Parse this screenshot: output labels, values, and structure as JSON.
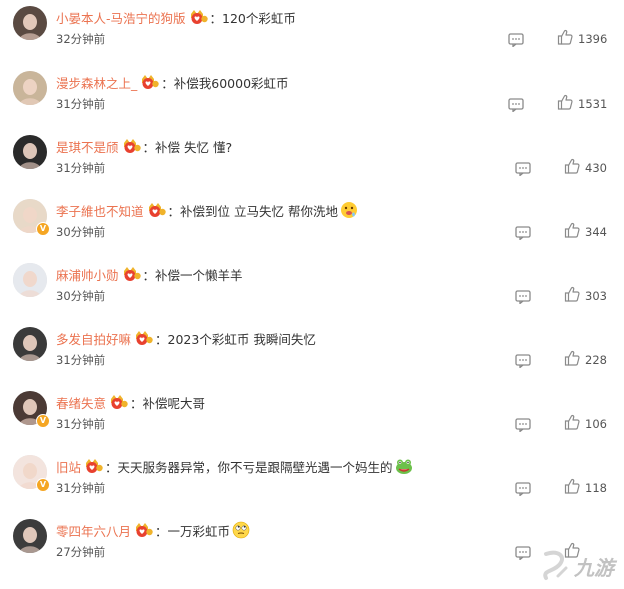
{
  "comments": [
    {
      "username": "小晏本人-马浩宁的狗版",
      "text": "120个彩虹币",
      "time": "32分钟前",
      "likes": "1396",
      "verified": false,
      "emoji": "",
      "avatar_color": "#5a4a42"
    },
    {
      "username": "漫步森林之上_",
      "text": "补偿我60000彩虹币",
      "time": "31分钟前",
      "likes": "1531",
      "verified": false,
      "emoji": "",
      "avatar_color": "#c9b59a"
    },
    {
      "username": "是琪不是颀",
      "text": "补偿 失忆 懂?",
      "time": "31分钟前",
      "likes": "430",
      "verified": false,
      "emoji": "",
      "avatar_color": "#2a2a2a"
    },
    {
      "username": "李子維也不知道",
      "text": "补偿到位 立马失忆 帮你洗地",
      "time": "30分钟前",
      "likes": "344",
      "verified": true,
      "emoji": "drool-face-emoji",
      "avatar_color": "#e8d9c8"
    },
    {
      "username": "麻浦帅小勋",
      "text": "补偿一个懒羊羊",
      "time": "30分钟前",
      "likes": "303",
      "verified": false,
      "emoji": "",
      "avatar_color": "#e6e9ee"
    },
    {
      "username": "多发自拍好嘛",
      "text": "2023个彩虹币 我瞬间失忆",
      "time": "31分钟前",
      "likes": "228",
      "verified": false,
      "emoji": "",
      "avatar_color": "#3a3a3a"
    },
    {
      "username": "春绪失意",
      "text": "补偿呢大哥",
      "time": "31分钟前",
      "likes": "106",
      "verified": true,
      "emoji": "",
      "avatar_color": "#4b3a35"
    },
    {
      "username": "旧站",
      "text": "天天服务器异常，你不亏是跟隔壁光遇一个妈生的",
      "time": "31分钟前",
      "likes": "118",
      "verified": true,
      "emoji": "frog-emoji",
      "avatar_color": "#f3e4de"
    },
    {
      "username": "零四年六八月",
      "text": "一万彩虹币",
      "time": "27分钟前",
      "likes": "",
      "verified": false,
      "emoji": "rolling-eyes-emoji",
      "avatar_color": "#3c3c3c"
    }
  ],
  "colors": {
    "username": "#eb7350",
    "text": "#333333",
    "meta": "#555555",
    "icon": "#8a8a8a"
  },
  "icons": {
    "reply": "comment-icon",
    "like": "thumbs-up-icon",
    "medal": "fan-medal-icon"
  },
  "watermark": {
    "brand": "九游"
  }
}
